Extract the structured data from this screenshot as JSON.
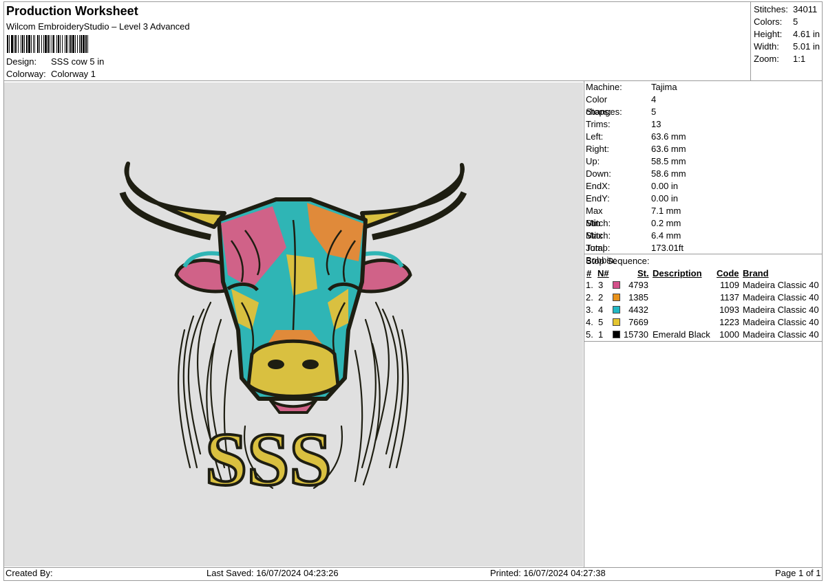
{
  "header": {
    "title": "Production Worksheet",
    "subtitle": "Wilcom EmbroideryStudio – Level 3 Advanced",
    "design_label": "Design:",
    "design_value": "SSS cow 5 in",
    "colorway_label": "Colorway:",
    "colorway_value": "Colorway 1"
  },
  "summary": [
    {
      "label": "Stitches:",
      "value": "34011"
    },
    {
      "label": "Colors:",
      "value": "5"
    },
    {
      "label": "Height:",
      "value": "4.61 in"
    },
    {
      "label": "Width:",
      "value": "5.01 in"
    },
    {
      "label": "Zoom:",
      "value": "1:1"
    }
  ],
  "machine_info": [
    {
      "label": "Machine:",
      "value": "Tajima"
    },
    {
      "label": "Color changes:",
      "value": "4"
    },
    {
      "label": "Stops:",
      "value": "5"
    },
    {
      "label": "Trims:",
      "value": "13"
    },
    {
      "label": "Left:",
      "value": "63.6 mm"
    },
    {
      "label": "Right:",
      "value": "63.6 mm"
    },
    {
      "label": "Up:",
      "value": "58.5 mm"
    },
    {
      "label": "Down:",
      "value": "58.6 mm"
    },
    {
      "label": "EndX:",
      "value": "0.00 in"
    },
    {
      "label": "EndY:",
      "value": "0.00 in"
    },
    {
      "label": "Max Stitch:",
      "value": "7.1 mm"
    },
    {
      "label": "Min Stitch:",
      "value": "0.2 mm"
    },
    {
      "label": "Max Jump:",
      "value": "6.4 mm"
    },
    {
      "label": "Total Bobbin:",
      "value": "173.01ft"
    }
  ],
  "stop_sequence": {
    "title": "Stop Sequence:",
    "headers": {
      "num": "#",
      "n": "N#",
      "st": "St.",
      "description": "Description",
      "code": "Code",
      "brand": "Brand"
    },
    "rows": [
      {
        "num": "1.",
        "n": "3",
        "color": "#d4508a",
        "st": "4793",
        "description": "",
        "code": "1109",
        "brand": "Madeira Classic 40"
      },
      {
        "num": "2.",
        "n": "2",
        "color": "#e8921c",
        "st": "1385",
        "description": "",
        "code": "1137",
        "brand": "Madeira Classic 40"
      },
      {
        "num": "3.",
        "n": "4",
        "color": "#22b8c4",
        "st": "4432",
        "description": "",
        "code": "1093",
        "brand": "Madeira Classic 40"
      },
      {
        "num": "4.",
        "n": "5",
        "color": "#e4c530",
        "st": "7669",
        "description": "",
        "code": "1223",
        "brand": "Madeira Classic 40"
      },
      {
        "num": "5.",
        "n": "1",
        "color": "#000000",
        "st": "15730",
        "description": "Emerald Black",
        "code": "1000",
        "brand": "Madeira Classic 40"
      }
    ]
  },
  "design_preview": {
    "lettering": "SSS",
    "colors": {
      "black": "#1e1e12",
      "yellow": "#d9c040",
      "teal": "#2fb5b5",
      "pink": "#d06288",
      "orange": "#e08a3a",
      "bg": "#e0e0e0"
    }
  },
  "footer": {
    "created_by": "Created By:",
    "last_saved": "Last Saved: 16/07/2024 04:23:26",
    "printed": "Printed: 16/07/2024 04:27:38",
    "page": "Page 1 of 1"
  }
}
